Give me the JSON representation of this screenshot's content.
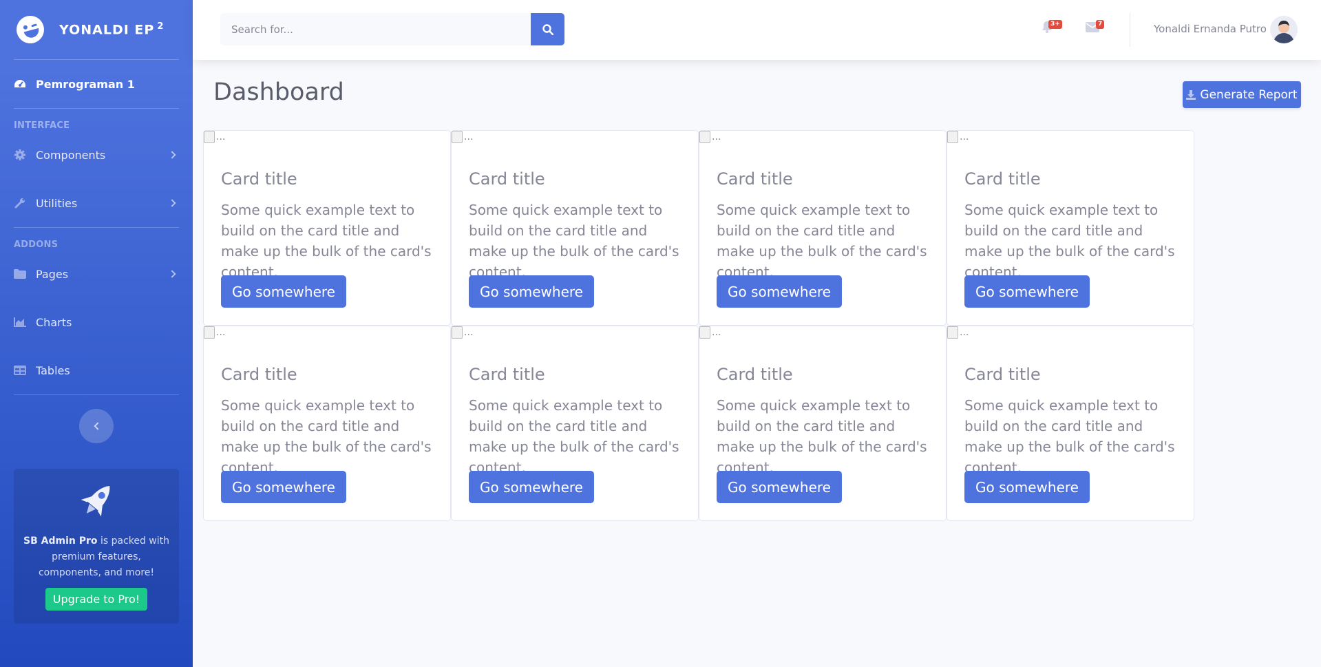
{
  "brand": {
    "name": "YONALDI EP",
    "sup": "2"
  },
  "sidebar": {
    "active_item": "Pemrograman 1",
    "heading_interface": "INTERFACE",
    "heading_addons": "ADDONS",
    "items": [
      {
        "label": "Components",
        "icon": "gear-icon",
        "has_children": true
      },
      {
        "label": "Utilities",
        "icon": "wrench-icon",
        "has_children": true
      },
      {
        "label": "Pages",
        "icon": "folder-icon",
        "has_children": true
      },
      {
        "label": "Charts",
        "icon": "chart-area-icon",
        "has_children": false
      },
      {
        "label": "Tables",
        "icon": "table-icon",
        "has_children": false
      }
    ],
    "promo": {
      "strong": "SB Admin Pro",
      "text": " is packed with premium features, components, and more!",
      "button": "Upgrade to Pro!"
    }
  },
  "topbar": {
    "search_placeholder": "Search for...",
    "alerts_badge": "3+",
    "messages_badge": "7",
    "user_name": "Yonaldi Ernanda Putro"
  },
  "main": {
    "title": "Dashboard",
    "generate_report": "Generate Report",
    "cards": [
      {
        "img_alt": "...",
        "title": "Card title",
        "text": "Some quick example text to build on the card title and make up the bulk of the card's content.",
        "button": "Go somewhere"
      },
      {
        "img_alt": "...",
        "title": "Card title",
        "text": "Some quick example text to build on the card title and make up the bulk of the card's content.",
        "button": "Go somewhere"
      },
      {
        "img_alt": "...",
        "title": "Card title",
        "text": "Some quick example text to build on the card title and make up the bulk of the card's content.",
        "button": "Go somewhere"
      },
      {
        "img_alt": "...",
        "title": "Card title",
        "text": "Some quick example text to build on the card title and make up the bulk of the card's content.",
        "button": "Go somewhere"
      },
      {
        "img_alt": "...",
        "title": "Card title",
        "text": "Some quick example text to build on the card title and make up the bulk of the card's content.",
        "button": "Go somewhere"
      },
      {
        "img_alt": "...",
        "title": "Card title",
        "text": "Some quick example text to build on the card title and make up the bulk of the card's content.",
        "button": "Go somewhere"
      },
      {
        "img_alt": "...",
        "title": "Card title",
        "text": "Some quick example text to build on the card title and make up the bulk of the card's content.",
        "button": "Go somewhere"
      },
      {
        "img_alt": "...",
        "title": "Card title",
        "text": "Some quick example text to build on the card title and make up the bulk of the card's content.",
        "button": "Go somewhere"
      }
    ]
  },
  "colors": {
    "primary": "#4e73df",
    "success": "#1cc88a",
    "danger": "#e74a3b",
    "text": "#858796",
    "heading": "#5a5c69"
  }
}
